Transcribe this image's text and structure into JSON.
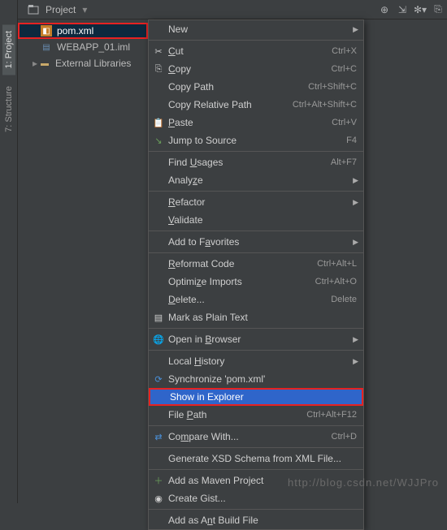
{
  "toolbar": {
    "project_label": "Project"
  },
  "sidebar_tabs": {
    "project": "1: Project",
    "structure": "7: Structure"
  },
  "tree": {
    "pom": "pom.xml",
    "iml": "WEBAPP_01.iml",
    "libs": "External Libraries"
  },
  "menu": {
    "new": "New",
    "cut": "Cut",
    "cut_sc": "Ctrl+X",
    "copy": "Copy",
    "copy_sc": "Ctrl+C",
    "copy_path": "Copy Path",
    "copy_path_sc": "Ctrl+Shift+C",
    "copy_rel": "Copy Relative Path",
    "copy_rel_sc": "Ctrl+Alt+Shift+C",
    "paste": "Paste",
    "paste_sc": "Ctrl+V",
    "jump": "Jump to Source",
    "jump_sc": "F4",
    "find": "Find Usages",
    "find_sc": "Alt+F7",
    "analyze": "Analyze",
    "refactor": "Refactor",
    "validate": "Validate",
    "favorites": "Add to Favorites",
    "reformat": "Reformat Code",
    "reformat_sc": "Ctrl+Alt+L",
    "optimize": "Optimize Imports",
    "optimize_sc": "Ctrl+Alt+O",
    "delete": "Delete...",
    "delete_sc": "Delete",
    "plain": "Mark as Plain Text",
    "browser": "Open in Browser",
    "history": "Local History",
    "sync": "Synchronize 'pom.xml'",
    "explorer": "Show in Explorer",
    "filepath": "File Path",
    "filepath_sc": "Ctrl+Alt+F12",
    "compare": "Compare With...",
    "compare_sc": "Ctrl+D",
    "xsd": "Generate XSD Schema from XML File...",
    "maven": "Add as Maven Project",
    "gist": "Create Gist...",
    "ant": "Add as Ant Build File"
  },
  "watermark": "http://blog.csdn.net/WJJPro"
}
